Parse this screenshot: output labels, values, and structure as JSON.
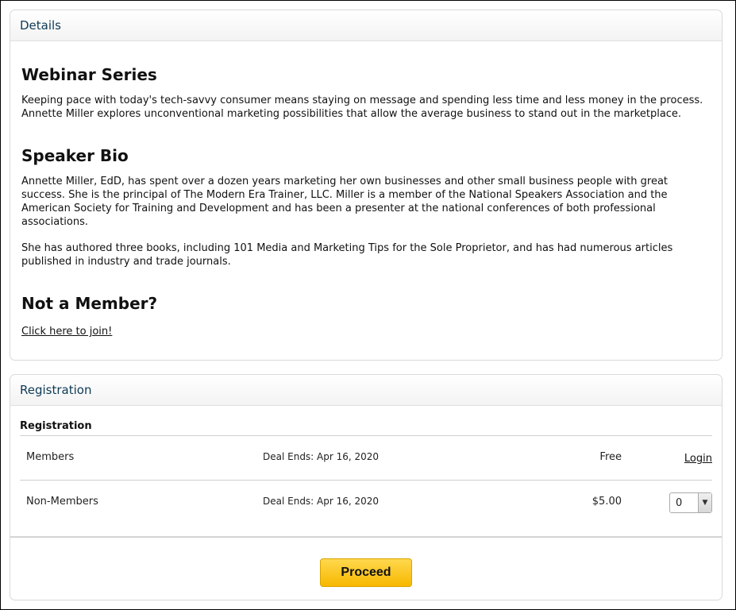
{
  "details": {
    "header": "Details",
    "webinar": {
      "heading": "Webinar Series",
      "text": "Keeping pace with today's tech-savvy consumer means staying on message and spending less time and less money in the process. Annette Miller explores unconventional marketing possibilities that allow the average business to stand out in the marketplace."
    },
    "bio": {
      "heading": "Speaker Bio",
      "paragraphs": [
        "Annette Miller, EdD, has spent over a dozen years marketing her own businesses and other small business people with great success. She is the principal of The Modern Era Trainer, LLC. Miller is a member of the National Speakers Association and the American Society for Training and Development and has been a presenter at the national conferences of both professional associations.",
        "She has authored three books, including 101 Media and Marketing Tips for the Sole Proprietor, and has had numerous articles published in industry and trade journals."
      ]
    },
    "membership": {
      "heading": "Not a Member?",
      "link": "Click here to join!"
    }
  },
  "registration": {
    "header": "Registration",
    "subtitle": "Registration",
    "rows": [
      {
        "name": "Members",
        "deal": "Deal Ends: Apr 16, 2020",
        "price": "Free",
        "action": "Login"
      },
      {
        "name": "Non-Members",
        "deal": "Deal Ends: Apr 16, 2020",
        "price": "$5.00",
        "quantity": "0"
      }
    ],
    "proceed": "Proceed"
  }
}
